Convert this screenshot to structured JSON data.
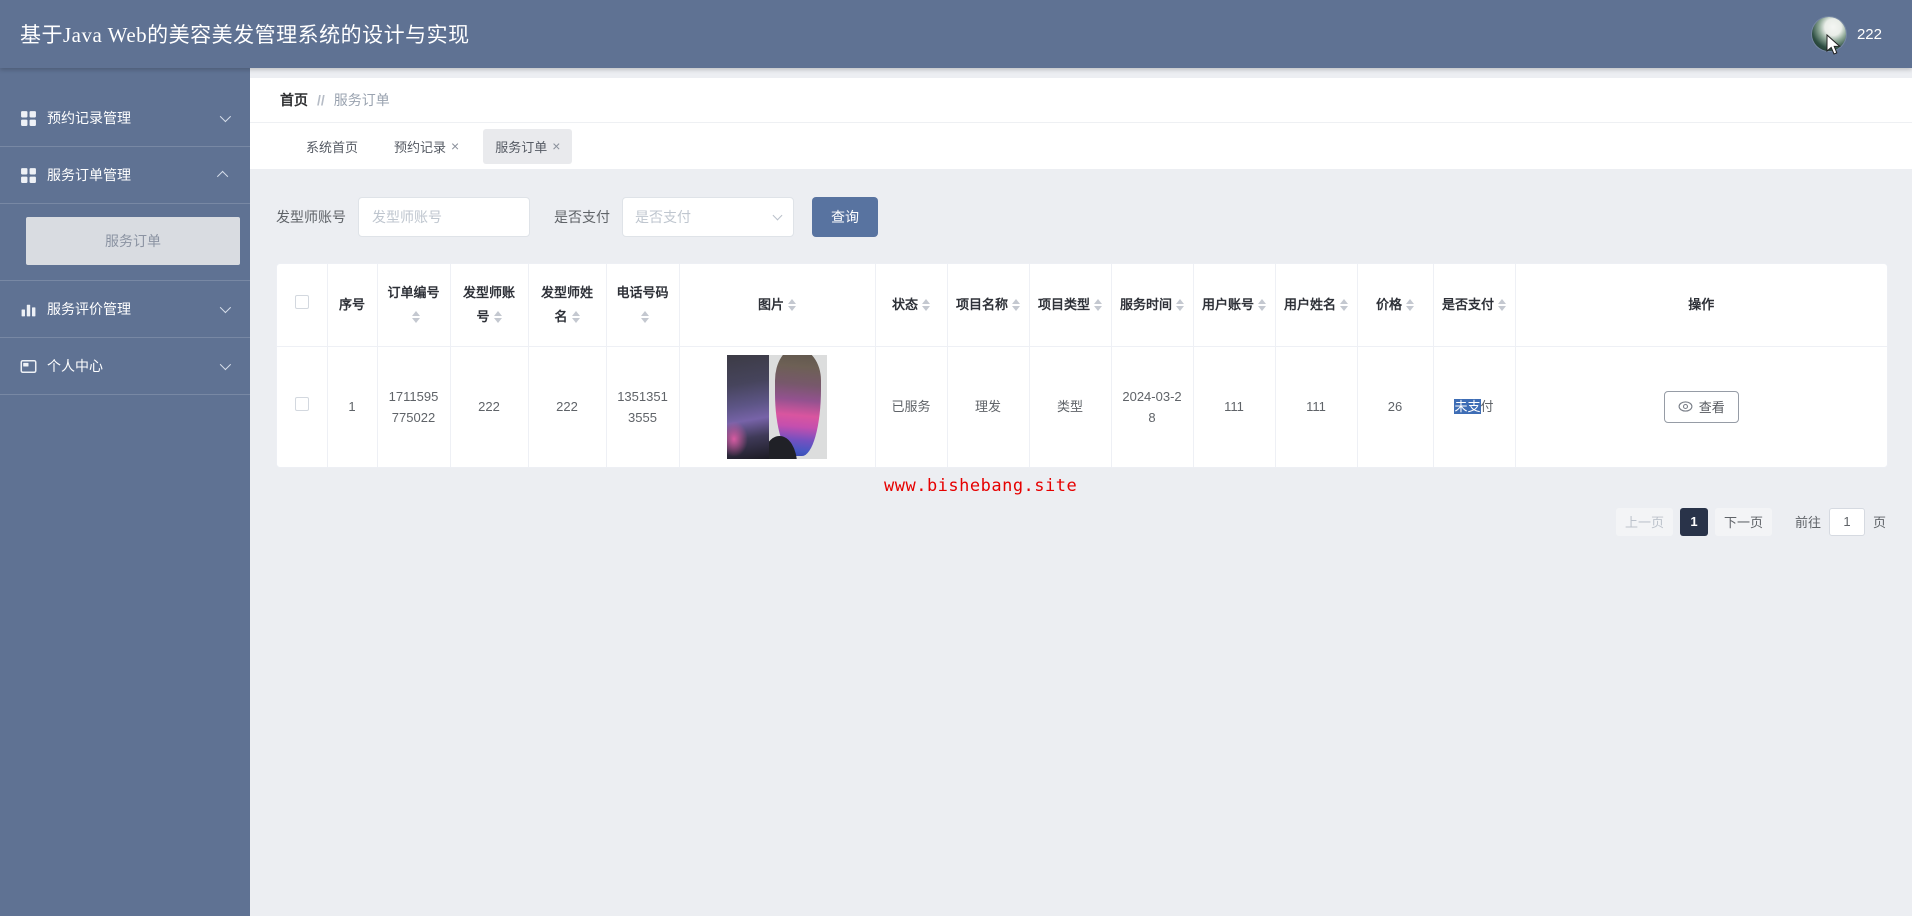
{
  "header": {
    "title": "基于Java Web的美容美发管理系统的设计与实现",
    "username": "222"
  },
  "sidebar": {
    "items": [
      {
        "label": "预约记录管理",
        "icon": "grid-icon",
        "state": "collapsed"
      },
      {
        "label": "服务订单管理",
        "icon": "grid-icon",
        "state": "expanded",
        "children": [
          {
            "label": "服务订单",
            "active": true
          }
        ]
      },
      {
        "label": "服务评价管理",
        "icon": "bar-chart-icon",
        "state": "collapsed"
      },
      {
        "label": "个人中心",
        "icon": "profile-card-icon",
        "state": "collapsed"
      }
    ]
  },
  "breadcrumb": {
    "root": "首页",
    "separator": "//",
    "current": "服务订单"
  },
  "tabs": [
    {
      "label": "系统首页",
      "closable": false,
      "active": false
    },
    {
      "label": "预约记录",
      "closable": true,
      "active": false
    },
    {
      "label": "服务订单",
      "closable": true,
      "active": true
    }
  ],
  "icons": {
    "close": "×"
  },
  "search": {
    "account_label": "发型师账号",
    "account_placeholder": "发型师账号",
    "pay_label": "是否支付",
    "pay_placeholder": "是否支付",
    "submit_label": "查询"
  },
  "table": {
    "columns": [
      "序号",
      "订单编号",
      "发型师账号",
      "发型师姓名",
      "电话号码",
      "图片",
      "状态",
      "项目名称",
      "项目类型",
      "服务时间",
      "用户账号",
      "用户姓名",
      "价格",
      "是否支付",
      "操作"
    ],
    "rows": [
      {
        "index": "1",
        "order_no": "1711595775022",
        "stylist_account": "222",
        "stylist_name": "222",
        "phone": "13513513555",
        "image": "hair-dye-photo",
        "status": "已服务",
        "project_name": "理发",
        "project_type": "类型",
        "service_time": "2024-03-28",
        "user_account": "111",
        "user_name": "111",
        "price": "26",
        "pay_status_selected": "未支",
        "pay_status_rest": "付",
        "action": "查看"
      }
    ]
  },
  "watermark": "www.bishebang.site",
  "pagination": {
    "prev": "上一页",
    "current_page": "1",
    "next": "下一页",
    "goto_label": "前往",
    "goto_value": "1",
    "page_unit": "页"
  },
  "colors": {
    "accent": "#5f7293",
    "primary_button": "#5873a0",
    "selection_highlight": "#3e6db5",
    "watermark_red": "#e60000",
    "pagination_active_bg": "#293349",
    "content_bg": "#eceef2"
  }
}
